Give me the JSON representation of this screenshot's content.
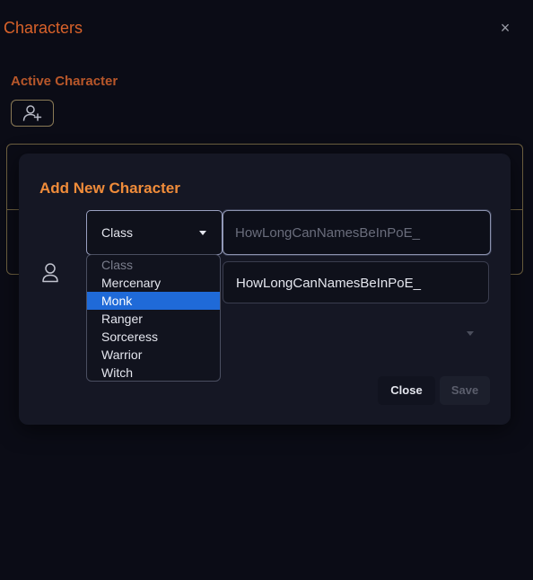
{
  "window": {
    "title": "Characters",
    "close_glyph": "×"
  },
  "section": {
    "active_label": "Active Character",
    "add_icon": "user-plus-icon"
  },
  "modal": {
    "title": "Add New Character",
    "class_select": {
      "value": "Class"
    },
    "name_input": {
      "placeholder": "HowLongCanNamesBeInPoE_"
    },
    "name_field_value": "HowLongCanNamesBeInPoE_",
    "buttons": {
      "close": "Close",
      "save": "Save"
    }
  },
  "dropdown": {
    "options": [
      "Class",
      "Mercenary",
      "Monk",
      "Ranger",
      "Sorceress",
      "Warrior",
      "Witch"
    ],
    "selected": "Monk"
  },
  "colors": {
    "accent_orange": "#f08c3a",
    "title_orange": "#d9622a",
    "selected_blue": "#1f6ad8",
    "background": "#0b0c16"
  }
}
